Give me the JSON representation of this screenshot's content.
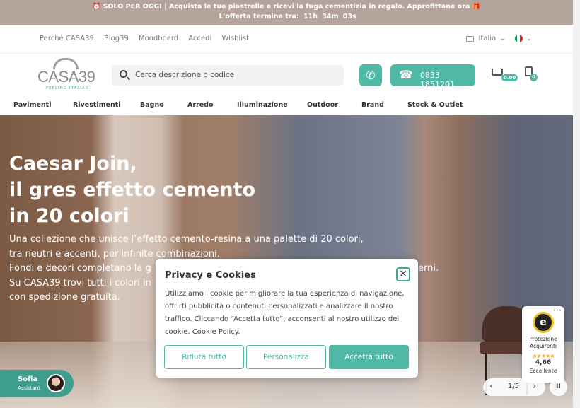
{
  "promo": {
    "line1": "⏰ SOLO PER OGGI | Acquista le tue piastrelle e ricevi la fuga cementizia in regalo. Approfittane ora 🎁",
    "line2_prefix": "L'offerta termina tra:",
    "hours": "11h",
    "minutes": "34m",
    "seconds": "03s"
  },
  "util": {
    "links": [
      "Perché CASA39",
      "Blog39",
      "Moodboard",
      "Accedi",
      "Wishlist"
    ],
    "country": "Italia",
    "flag_colors": [
      "#009246",
      "#ffffff",
      "#ce2b37"
    ]
  },
  "header": {
    "logo_word": "CASA39",
    "logo_tagline": "FEELING ITALIAN",
    "search_placeholder": "Cerca descrizione o codice",
    "phone": "0833 1851201",
    "cart_total": "0.00",
    "quote_count": "0",
    "accent": "#4fb9a6"
  },
  "nav": [
    "Pavimenti",
    "Rivestimenti",
    "Bagno",
    "Arredo",
    "Illuminazione",
    "Outdoor",
    "Brand",
    "Stock & Outlet"
  ],
  "hero": {
    "title_lines": [
      "Caesar Join,",
      "il gres effetto cemento",
      "in 20 colori"
    ],
    "desc_lines": [
      "Una collezione che unisce l’effetto cemento-resina a una palette di 20 colori,",
      "tra neutri e accenti, per infinite combinazioni.",
      "Fondi e decori completano la g",
      "Su CASA39 trovi tutti i colori in",
      "con spedizione gratuita."
    ],
    "desc_tail": "erni."
  },
  "chat": {
    "name": "Sofia",
    "role": "Assistant"
  },
  "trust": {
    "line1": "Protezione",
    "line2": "Acquirenti",
    "stars": "★★★★★",
    "score": "4,66",
    "label": "Eccellente"
  },
  "slider": {
    "index": "1/5"
  },
  "cookie": {
    "title": "Privacy e Cookies",
    "body": "Utilizziamo i cookie per migliorare la tua esperienza di navigazione, offrirti pubblicità o contenuti personalizzati e analizzare il nostro traffico. Cliccando “Accetta tutto”, acconsenti al nostro utilizzo dei cookie. Cookie Policy.",
    "reject": "Rifiuta tutto",
    "customize": "Personalizza",
    "accept": "Accetta tutto"
  }
}
